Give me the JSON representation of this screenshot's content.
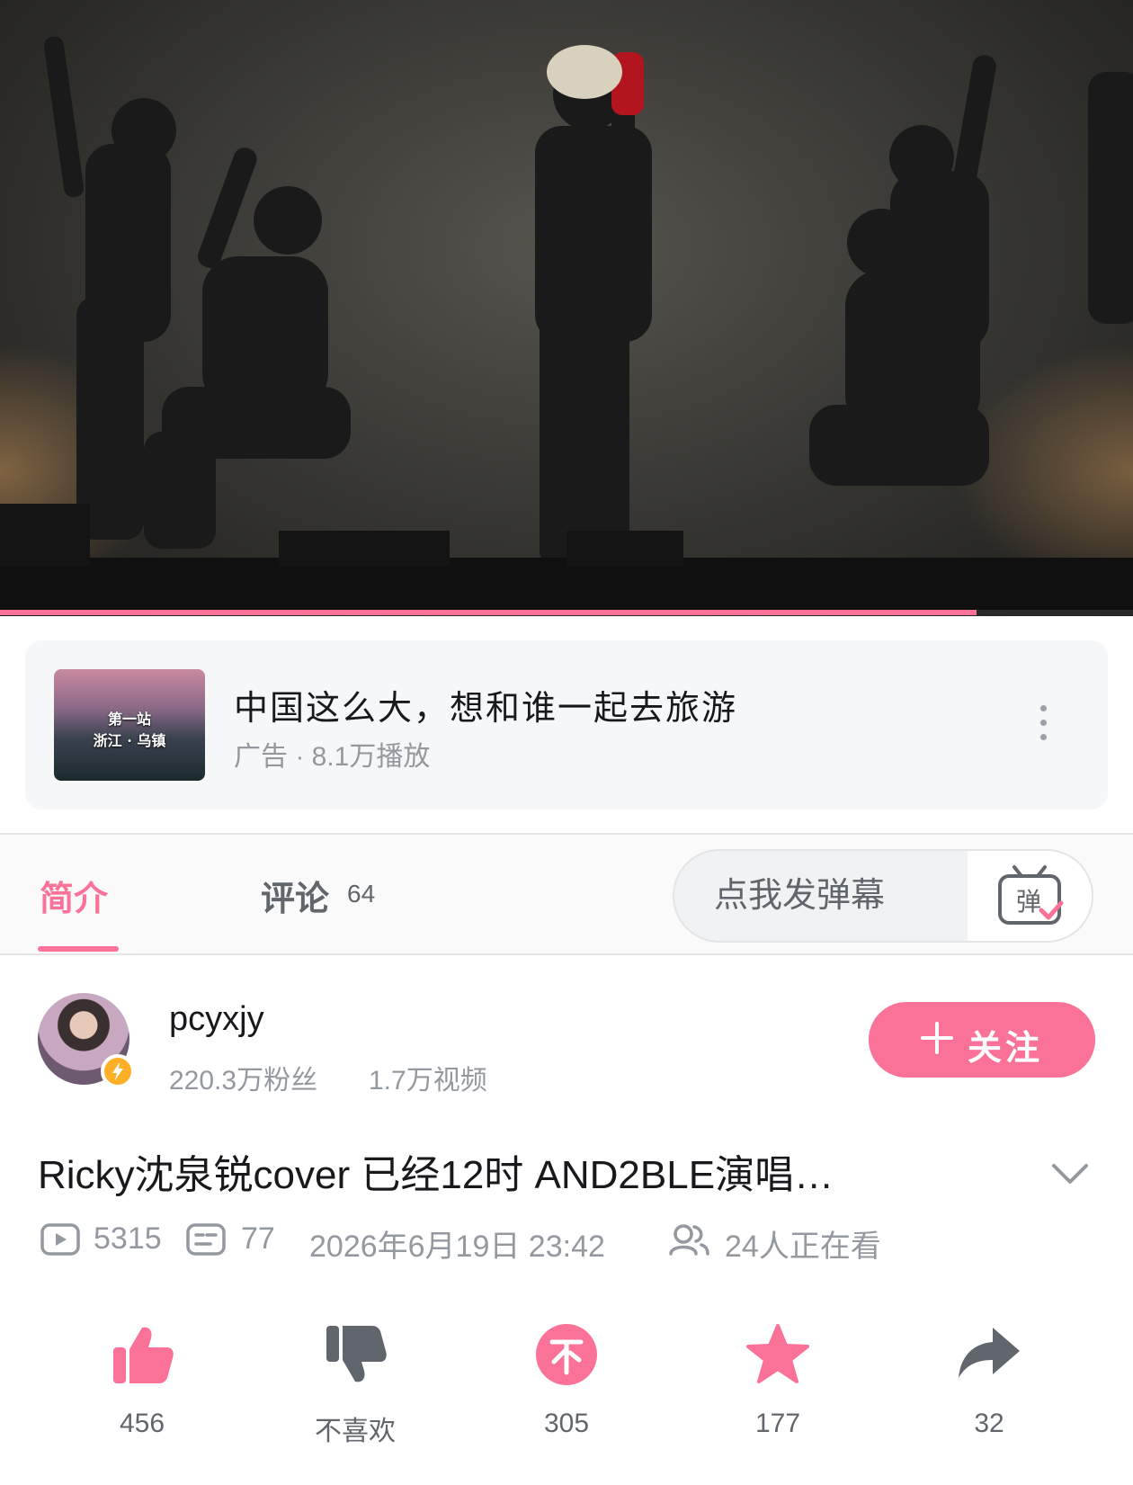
{
  "player": {
    "progress_fraction": 0.862
  },
  "ad": {
    "thumb_line1": "第一站",
    "thumb_line2": "浙江 · 乌镇",
    "title": "中国这么大，想和谁一起去旅游",
    "subtitle": "广告 · 8.1万播放"
  },
  "tabs": {
    "intro": "简介",
    "comments": "评论",
    "comments_count": "64"
  },
  "danmaku": {
    "placeholder": "点我发弹幕",
    "toggle_glyph": "弹"
  },
  "uploader": {
    "name": "pcyxjy",
    "fans": "220.3万粉丝",
    "videos": "1.7万视频",
    "follow_label": "关注"
  },
  "video": {
    "title": "Ricky沈泉锐cover 已经12时 AND2BLE演唱…",
    "plays": "5315",
    "danmaku_count": "77",
    "date": "2026年6月19日 23:42",
    "watching": "24人正在看"
  },
  "actions": {
    "like": "456",
    "dislike": "不喜欢",
    "coin": "305",
    "favorite": "177",
    "share": "32"
  },
  "colors": {
    "accent": "#fb7299",
    "text_primary": "#18191c",
    "text_secondary": "#9499a0",
    "icon_gray": "#61666d"
  }
}
